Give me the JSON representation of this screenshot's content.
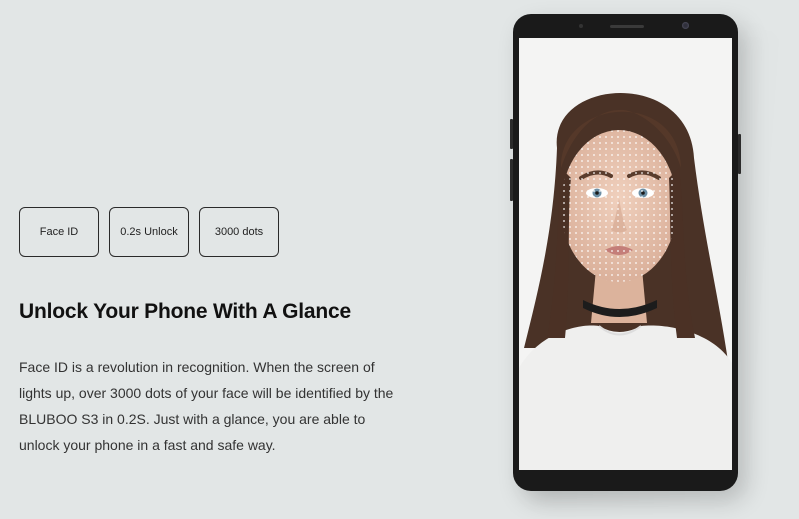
{
  "features": [
    {
      "label": "Face ID"
    },
    {
      "label": "0.2s Unlock"
    },
    {
      "label": "3000 dots"
    }
  ],
  "heading": "Unlock Your Phone With A Glance",
  "description": "Face ID is a revolution in recognition. When the screen of lights up, over 3000 dots of your face will be identified by the BLUBOO S3 in 0.2S. Just with a glance, you are able to unlock your phone in a fast and safe way.",
  "colors": {
    "background": "#e2e6e6",
    "phone_body": "#1a1a1a",
    "text_dark": "#111111"
  }
}
